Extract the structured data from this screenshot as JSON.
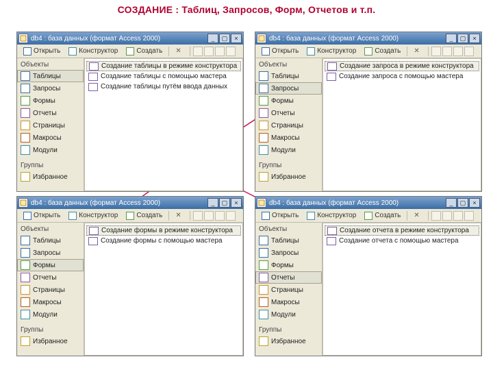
{
  "heading": "СОЗДАНИЕ :  Таблиц, Запросов,  Форм,  Отчетов  и т.п.",
  "titlebar_title": "db4 : база данных (формат Access 2000)",
  "toolbar": {
    "open": "Открыть",
    "design": "Конструктор",
    "create": "Создать"
  },
  "sidebar": {
    "header": "Объекты",
    "items": [
      {
        "label": "Таблицы"
      },
      {
        "label": "Запросы"
      },
      {
        "label": "Формы"
      },
      {
        "label": "Отчеты"
      },
      {
        "label": "Страницы"
      },
      {
        "label": "Макросы"
      },
      {
        "label": "Модули"
      }
    ],
    "groups_label": "Группы",
    "favorites": "Избранное"
  },
  "panels": [
    {
      "active_index": 0,
      "list": [
        "Создание таблицы в режиме конструктора",
        "Создание таблицы с помощью мастера",
        "Создание таблицы путём ввода данных"
      ]
    },
    {
      "active_index": 1,
      "list": [
        "Создание запроса в режиме конструктора",
        "Создание запроса с помощью мастера"
      ]
    },
    {
      "active_index": 2,
      "list": [
        "Создание формы в режиме конструктора",
        "Создание формы с помощью мастера"
      ]
    },
    {
      "active_index": 3,
      "list": [
        "Создание отчета в режиме конструктора",
        "Создание отчета с помощью мастера"
      ]
    }
  ]
}
